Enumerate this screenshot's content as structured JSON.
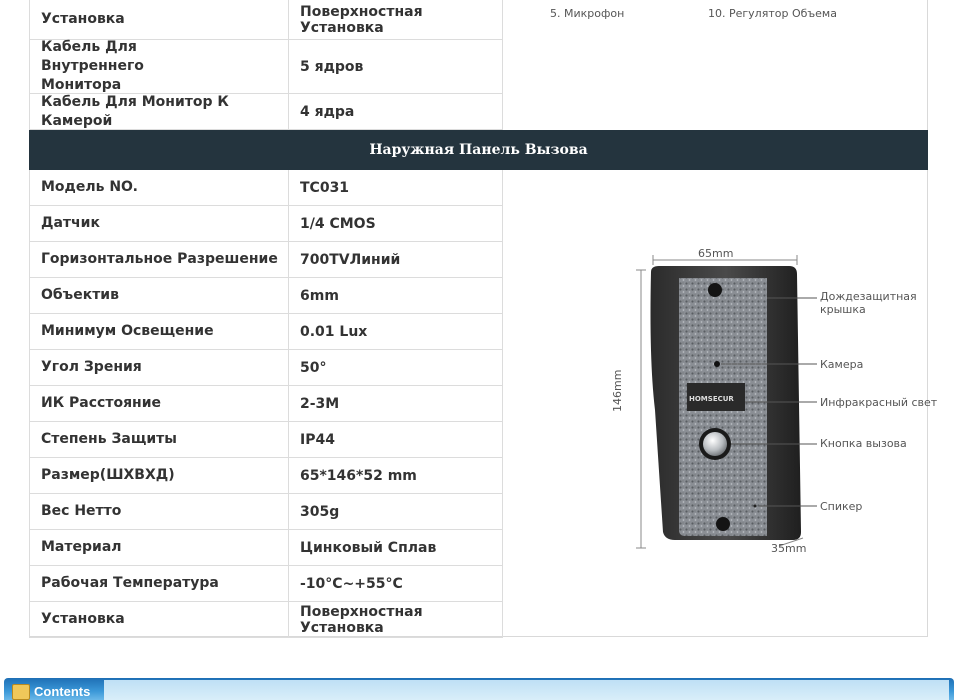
{
  "top_table": [
    {
      "key": "Установка",
      "value": "Поверхностная Установка"
    },
    {
      "key": "Кабель Для Внутреннего Монитора",
      "value": "5 ядров"
    },
    {
      "key": "Кабель Для Монитор К Камерой",
      "value": "4 ядра"
    }
  ],
  "top_notes": {
    "left": "5. Микрофон",
    "right": "10. Регулятор Объема"
  },
  "section_title": "Наружная Панель Вызова",
  "main_table": [
    {
      "key": "Модель NO.",
      "value": "TC031"
    },
    {
      "key": "Датчик",
      "value": "1/4 CMOS"
    },
    {
      "key": "Горизонтальное Разрешение",
      "value": "700TVЛиний"
    },
    {
      "key": "Объектив",
      "value": "6mm"
    },
    {
      "key": "Минимум Освещение",
      "value": "0.01 Lux"
    },
    {
      "key": "Угол Зрения",
      "value": "50°"
    },
    {
      "key": "ИК Расстояние",
      "value": "2-3M"
    },
    {
      "key": "Степень Защиты",
      "value": "IP44"
    },
    {
      "key": "Размер(ШХВХД)",
      "value": "65*146*52 mm"
    },
    {
      "key": "Вес Нетто",
      "value": "305g"
    },
    {
      "key": "Материал",
      "value": "Цинковый Сплав"
    },
    {
      "key": "Рабочая Температура",
      "value": "-10°C~+55°C"
    },
    {
      "key": "Установка",
      "value": "Поверхностная Установка"
    }
  ],
  "diagram": {
    "width_label": "65mm",
    "height_label": "146mm",
    "depth_label": "35mm",
    "brand": "HOMSECUR",
    "callouts": {
      "rain_cover": "Дождезащитная крышка",
      "camera": "Камера",
      "infrared": "Инфракрасный свет",
      "call_button": "Кнопка вызова",
      "speaker": "Спикер"
    }
  },
  "footer": {
    "title": "Contents"
  }
}
